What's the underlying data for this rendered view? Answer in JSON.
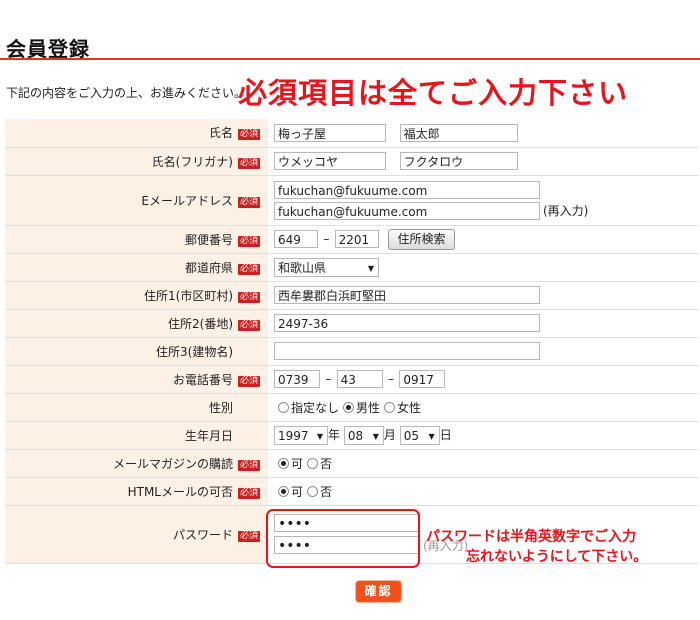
{
  "page": {
    "title": "会員登録",
    "intro": "下記の内容をご入力の上、お進みください。",
    "banner": "必須項目は全てご入力下さい",
    "required_badge": "必須",
    "accent_color": "#e8141b"
  },
  "fields": {
    "name": {
      "label": "氏名",
      "last": "梅っ子屋",
      "first": "福太郎"
    },
    "kana": {
      "label": "氏名(フリガナ)",
      "last": "ウメッコヤ",
      "first": "フクタロウ"
    },
    "email": {
      "label": "Eメールアドレス",
      "value": "fukuchan@fukuume.com",
      "confirm": "fukuchan@fukuume.com",
      "reenter_suffix": "(再入力)"
    },
    "zip": {
      "label": "郵便番号",
      "part1": "649",
      "part2": "2201",
      "separator": "–",
      "search_button": "住所検索"
    },
    "prefecture": {
      "label": "都道府県",
      "selected": "和歌山県"
    },
    "address1": {
      "label": "住所1(市区町村)",
      "value": "西牟婁郡白浜町堅田"
    },
    "address2": {
      "label": "住所2(番地)",
      "value": "2497-36"
    },
    "address3": {
      "label": "住所3(建物名)",
      "value": ""
    },
    "phone": {
      "label": "お電話番号",
      "part1": "0739",
      "part2": "43",
      "part3": "0917",
      "separator": "–"
    },
    "gender": {
      "label": "性別",
      "options": [
        "指定なし",
        "男性",
        "女性"
      ],
      "selected": "男性"
    },
    "birthday": {
      "label": "生年月日",
      "year": "1997",
      "year_unit": "年",
      "month": "08",
      "month_unit": "月",
      "day": "05",
      "day_unit": "日"
    },
    "newsletter": {
      "label": "メールマガジンの購読",
      "options": [
        "可",
        "否"
      ],
      "selected": "可"
    },
    "html_mail": {
      "label": "HTMLメールの可否",
      "options": [
        "可",
        "否"
      ],
      "selected": "可"
    },
    "password": {
      "label": "パスワード",
      "value": "••••",
      "confirm": "••••",
      "reenter_suffix": "(再入力)"
    }
  },
  "notes": {
    "password_note_line1": "パスワードは半角英数字でご入力",
    "password_note_line2": "忘れないようにして下さい。"
  },
  "actions": {
    "confirm_label": "確認"
  }
}
